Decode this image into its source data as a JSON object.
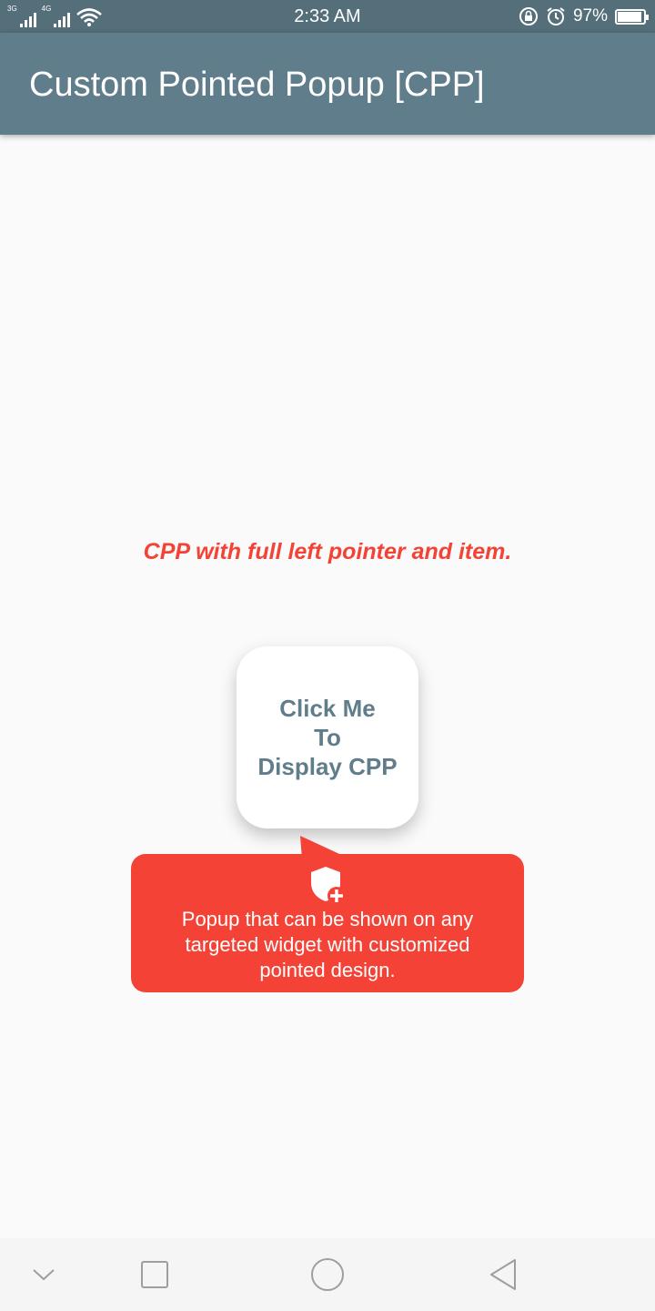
{
  "status_bar": {
    "network_1": "3G",
    "network_2": "4G",
    "time": "2:33 AM",
    "battery_percent": "97%",
    "battery_level": 0.97,
    "icons": [
      "signal-icon",
      "wifi-icon",
      "rotation-lock-icon",
      "alarm-icon",
      "battery-icon"
    ]
  },
  "app_bar": {
    "title": "Custom Pointed Popup [CPP]",
    "color": "#607d8b"
  },
  "content": {
    "subtitle": "CPP with full left pointer and item.",
    "button_lines": [
      "Click Me",
      "To",
      "Display CPP"
    ],
    "popup": {
      "icon": "shield-plus-icon",
      "text": "Popup that can be shown on any targeted widget with customized pointed design.",
      "color": "#f44336"
    }
  },
  "nav_bar": {
    "buttons": [
      "collapse-chevron-icon",
      "recents-square-icon",
      "home-circle-icon",
      "back-triangle-icon"
    ]
  }
}
